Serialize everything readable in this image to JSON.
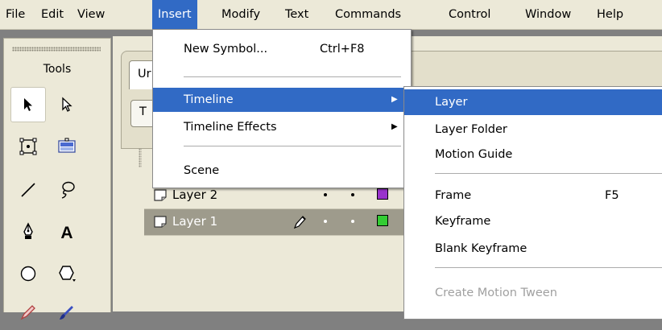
{
  "menubar": {
    "items": [
      "File",
      "Edit",
      "View",
      "Insert",
      "Modify",
      "Text",
      "Commands",
      "Control",
      "Window",
      "Help"
    ],
    "active": "Insert"
  },
  "tools": {
    "title": "Tools",
    "items": [
      "arrow-tool",
      "subselect-tool",
      "free-transform-tool",
      "fill-transform-tool",
      "line-tool",
      "lasso-tool",
      "pen-tool",
      "text-tool",
      "oval-tool",
      "polystar-tool",
      "pencil-tool",
      "brush-tool"
    ],
    "selected": "arrow-tool"
  },
  "document": {
    "tab_label": "Ur",
    "timeline_button": "T"
  },
  "layers": [
    {
      "name": "Layer 2",
      "color": "#9933cc",
      "selected": false,
      "editing": false
    },
    {
      "name": "Layer 1",
      "color": "#33cc33",
      "selected": true,
      "editing": true
    }
  ],
  "insert_menu": {
    "new_symbol": {
      "label": "New Symbol...",
      "shortcut": "Ctrl+F8"
    },
    "timeline": {
      "label": "Timeline",
      "highlighted": true,
      "has_submenu": true
    },
    "timeline_effects": {
      "label": "Timeline Effects",
      "has_submenu": true
    },
    "scene": {
      "label": "Scene"
    }
  },
  "timeline_submenu": {
    "layer": {
      "label": "Layer",
      "highlighted": true
    },
    "layer_folder": {
      "label": "Layer Folder"
    },
    "motion_guide": {
      "label": "Motion Guide"
    },
    "frame": {
      "label": "Frame",
      "shortcut": "F5"
    },
    "keyframe": {
      "label": "Keyframe"
    },
    "blank_keyframe": {
      "label": "Blank Keyframe"
    },
    "create_motion_tween": {
      "label": "Create Motion Tween",
      "disabled": true
    }
  },
  "colors": {
    "highlight": "#316ac5",
    "panel": "#ece9d8"
  }
}
